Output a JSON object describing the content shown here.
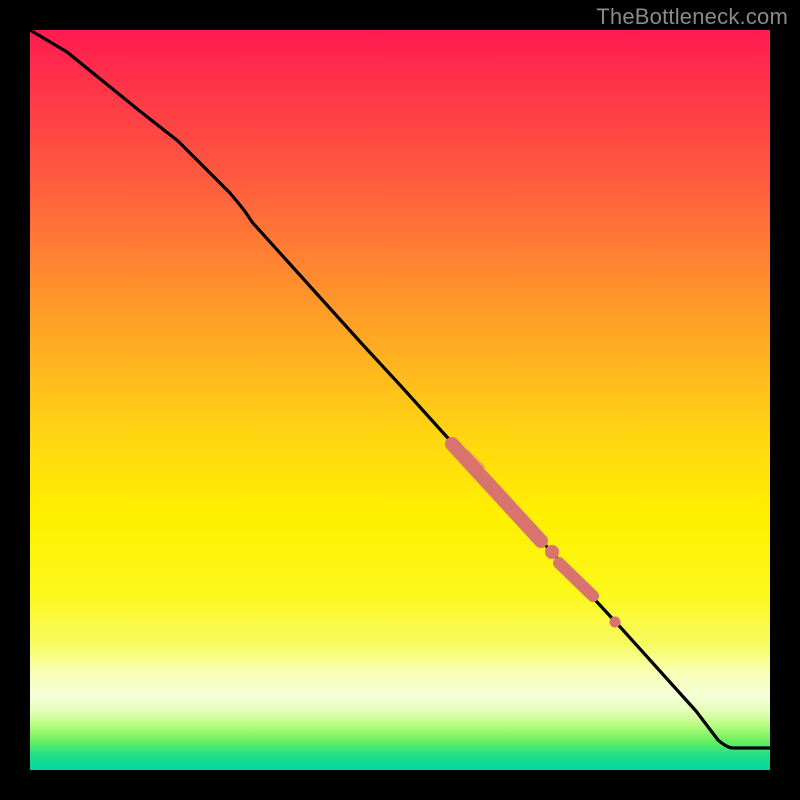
{
  "watermark": "TheBottleneck.com",
  "chart_data": {
    "type": "line",
    "title": "",
    "xlabel": "",
    "ylabel": "",
    "xlim": [
      0,
      100
    ],
    "ylim": [
      0,
      100
    ],
    "grid": false,
    "series": [
      {
        "name": "curve",
        "color": "#000000",
        "x": [
          0,
          5,
          10,
          15,
          20,
          25,
          27,
          30,
          35,
          40,
          45,
          50,
          55,
          60,
          65,
          70,
          75,
          80,
          85,
          90,
          93,
          95,
          100
        ],
        "y": [
          100,
          97,
          93,
          89,
          85,
          80,
          78,
          74,
          68.5,
          63,
          57.5,
          52,
          46.5,
          41,
          35.5,
          30,
          24.5,
          19,
          13.5,
          8,
          4,
          3.5,
          3.5
        ]
      }
    ],
    "markers": [
      {
        "name": "highlight-segment-1",
        "type": "thick-segment",
        "color": "#d9736e",
        "x_start": 57,
        "x_end": 69,
        "y_start": 44,
        "y_end": 31
      },
      {
        "name": "highlight-dot-1",
        "type": "dot",
        "color": "#d9736e",
        "x": 70.5,
        "y": 29.5
      },
      {
        "name": "highlight-segment-2",
        "type": "thick-segment",
        "color": "#d9736e",
        "x_start": 71.5,
        "x_end": 76,
        "y_start": 28,
        "y_end": 23.5
      },
      {
        "name": "highlight-dot-2",
        "type": "dot",
        "color": "#d9736e",
        "x": 79,
        "y": 20
      }
    ]
  }
}
